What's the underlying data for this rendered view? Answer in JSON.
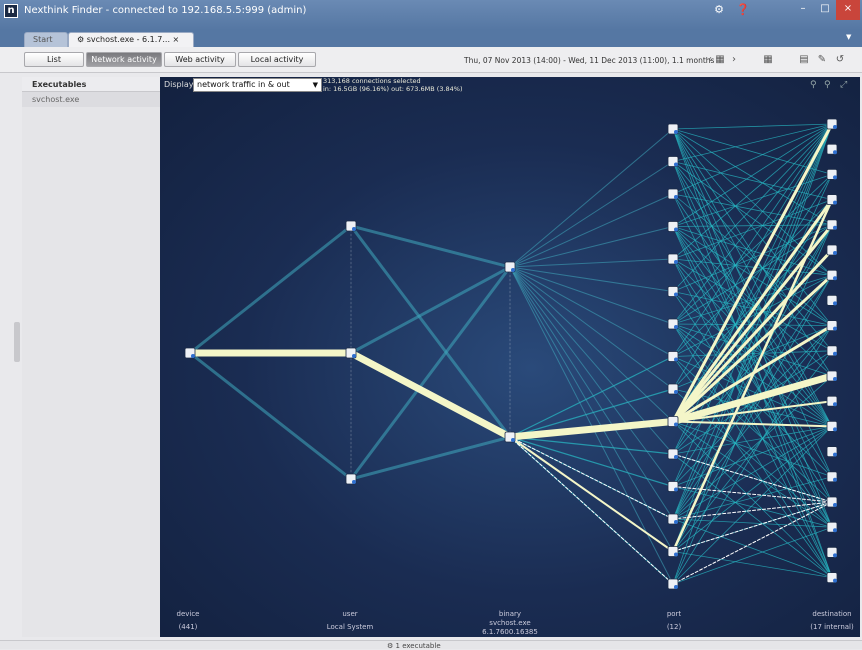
{
  "window": {
    "title": "Nexthink Finder - connected to 192.168.5.5:999 (admin)",
    "logo": "n",
    "minimize": "–",
    "maximize": "□",
    "close": "×"
  },
  "tabs": [
    {
      "label": "Start"
    },
    {
      "label": "svchost.exe - 6.1.7... ×"
    }
  ],
  "toolbar": {
    "buttons": [
      "List",
      "Network activity",
      "Web activity",
      "Local activity"
    ],
    "date_range": "Thu, 07 Nov 2013 (14:00) - Wed, 11 Dec 2013 (11:00), 1.1 months"
  },
  "sidebar": {
    "heading": "Executables",
    "items": [
      "svchost.exe"
    ]
  },
  "display": {
    "label": "Display",
    "value": "network traffic in & out"
  },
  "summary": {
    "line1": "313,168 connections selected",
    "line2": "in: 16.5GB (96.16%) out: 673.6MB (3.84%)"
  },
  "axes": [
    {
      "name": "device",
      "value": "(441)"
    },
    {
      "name": "user",
      "value": "Local System"
    },
    {
      "name": "binary",
      "value": "svchost.exe",
      "value2": "6.1.7600.16385"
    },
    {
      "name": "port",
      "value": "(12)"
    },
    {
      "name": "destination",
      "value": "(17 internal)"
    }
  ],
  "status": {
    "text": "1 executable"
  }
}
